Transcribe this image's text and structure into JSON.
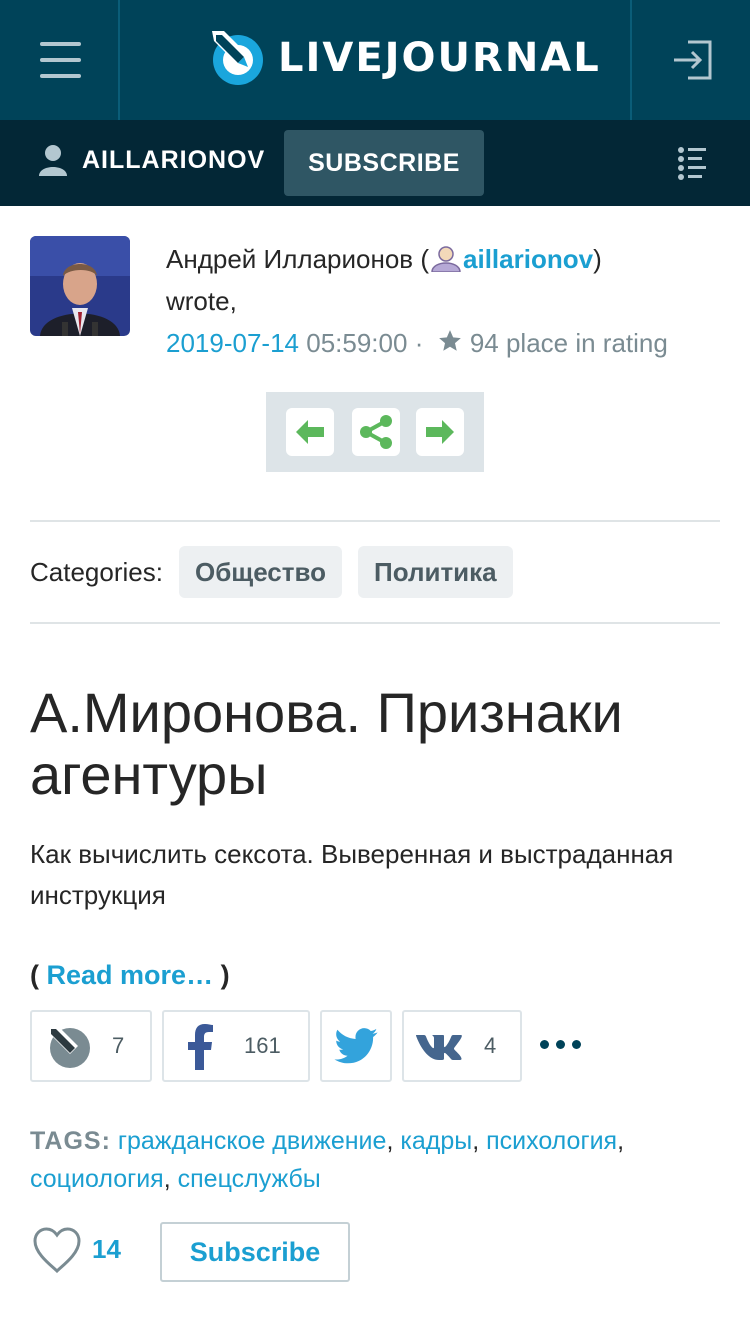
{
  "header": {
    "logo_text": "LIVEJOURNAL"
  },
  "subbar": {
    "username": "AILLARIONOV",
    "subscribe_label": "SUBSCRIBE"
  },
  "author": {
    "name": "Андрей Илларионов",
    "open_paren": "(",
    "username": "aillarionov",
    "close_paren": ")",
    "wrote": "wrote,",
    "date": "2019-07-14",
    "time": "05:59:00",
    "separator": "·",
    "rating": "94 place in rating"
  },
  "categories": {
    "label": "Categories:",
    "items": [
      "Общество",
      "Политика"
    ]
  },
  "post": {
    "title": "А.Миронова. Признаки агентуры",
    "lead": "Как вычислить сексота. Выверенная и выстраданная инструкция",
    "readmore_open": "(",
    "readmore_label": "Read more…",
    "readmore_close": ")"
  },
  "share": {
    "lj_count": "7",
    "facebook_count": "161",
    "vk_count": "4"
  },
  "tags": {
    "label": "TAGS:",
    "items": [
      "гражданское движение",
      "кадры",
      "психология",
      "социология",
      "спецслужбы"
    ],
    "sep": ","
  },
  "footer": {
    "likes": "14",
    "subscribe_label": "Subscribe"
  },
  "colors": {
    "header_bg": "#004359",
    "subbar_bg": "#032736",
    "link": "#1b9fd1",
    "nav_arrow": "#5cb85c"
  }
}
